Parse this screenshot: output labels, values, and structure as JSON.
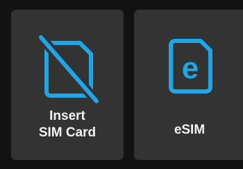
{
  "options": {
    "insert_sim": {
      "label_line1": "Insert",
      "label_line2": "SIM Card",
      "icon": "sim-card-off-icon"
    },
    "esim": {
      "label": "eSIM",
      "icon_letter": "e",
      "icon": "esim-icon"
    }
  },
  "colors": {
    "background": "#121212",
    "tile": "#333333",
    "icon_accent": "#1ea7e8",
    "label_text": "#f2f2f2"
  }
}
